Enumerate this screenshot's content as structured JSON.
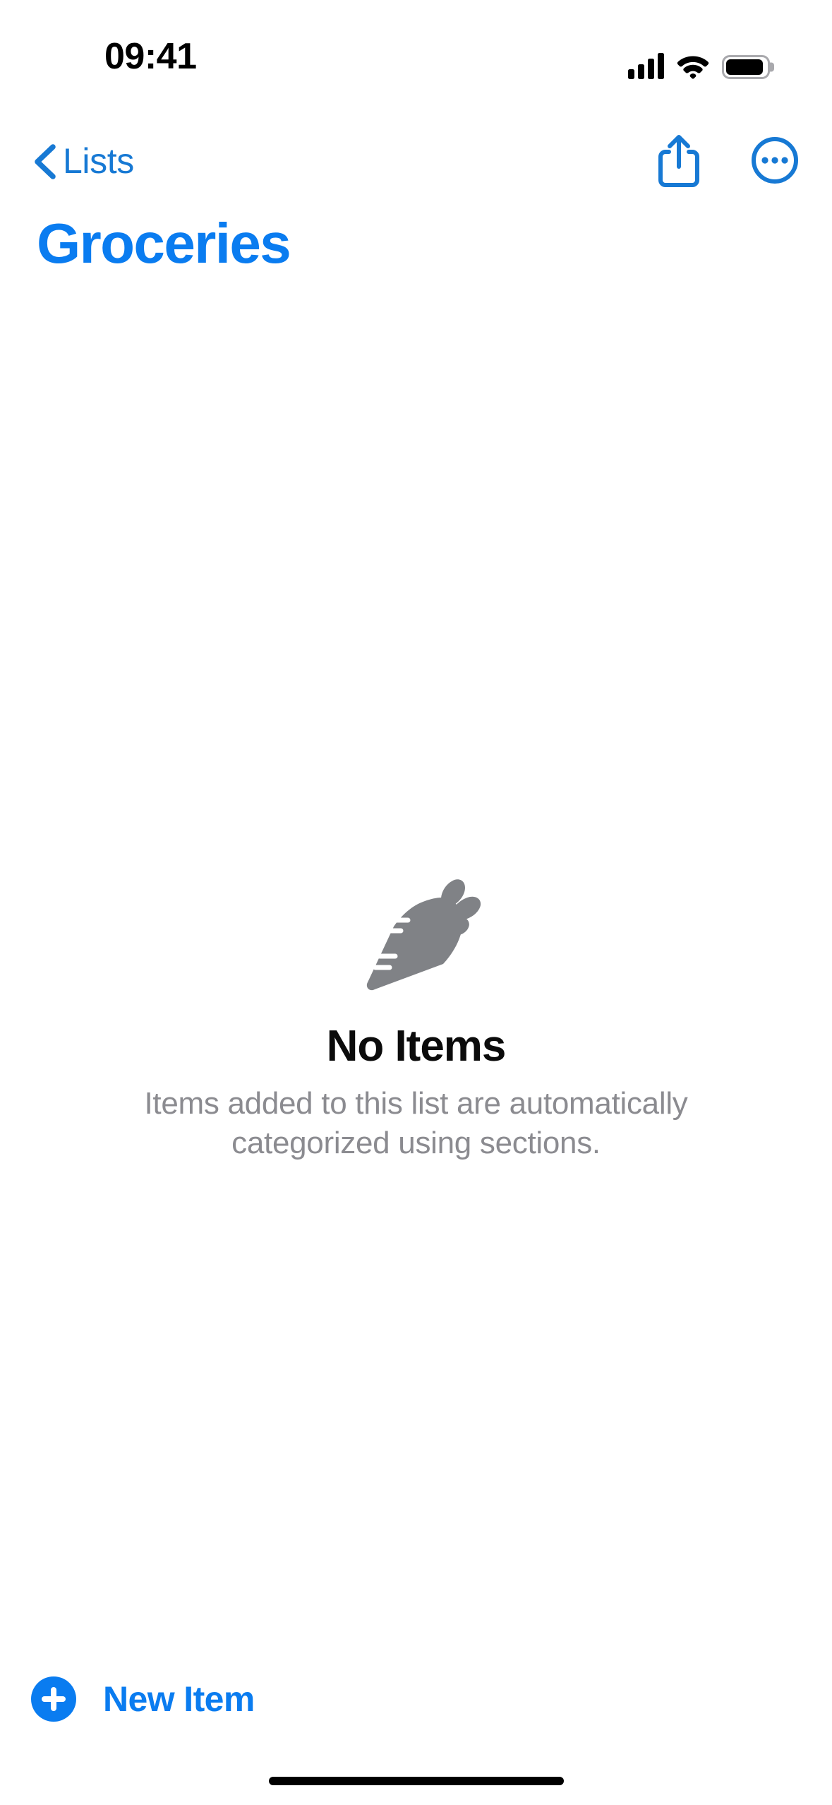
{
  "status_bar": {
    "time": "09:41",
    "cellular_icon": "cellular-signal-icon",
    "cellular_bars_filled": 4,
    "cellular_bars_total": 4,
    "wifi_icon": "wifi-icon",
    "wifi_strength": "full",
    "battery_icon": "battery-icon",
    "battery_level_percent": 92
  },
  "nav_bar": {
    "back_label": "Lists",
    "back_icon": "chevron-left-icon",
    "share_icon": "share-icon",
    "more_icon": "ellipsis-circle-icon"
  },
  "header": {
    "title": "Groceries",
    "title_color": "#0a7cf0"
  },
  "empty_state": {
    "icon": "carrot-icon",
    "icon_color": "#808286",
    "title": "No Items",
    "subtitle": "Items added to this list are automatically categorized using sections."
  },
  "toolbar": {
    "new_item_label": "New Item",
    "new_item_icon": "plus-circle-icon",
    "accent_color": "#0a7cf0"
  },
  "system": {
    "home_indicator": "home-indicator"
  }
}
